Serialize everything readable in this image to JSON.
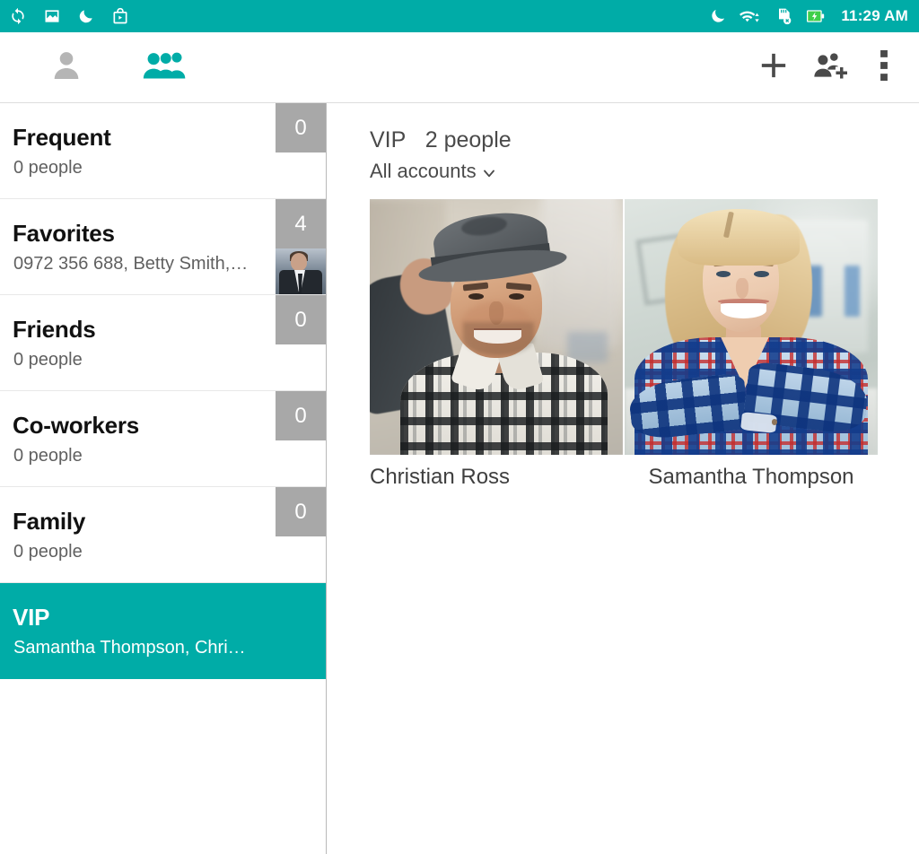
{
  "statusbar": {
    "time": "11:29 AM",
    "left_icons": [
      {
        "name": "sync-icon",
        "label": "sync"
      },
      {
        "name": "photo-icon",
        "label": "photo"
      },
      {
        "name": "do-not-disturb-moon-icon",
        "label": "do not disturb"
      },
      {
        "name": "app-store-bag-icon",
        "label": "store"
      }
    ],
    "right_icons": [
      {
        "name": "moon-icon",
        "label": "night mode"
      },
      {
        "name": "wifi-icon",
        "label": "wifi"
      },
      {
        "name": "sd-card-removed-icon",
        "label": "sd card removed"
      },
      {
        "name": "battery-charging-icon",
        "label": "battery charging"
      }
    ],
    "background_color": "#00ACA7"
  },
  "toolbar": {
    "tabs": [
      {
        "name": "contacts-tab",
        "icon": "person-icon",
        "active": false
      },
      {
        "name": "groups-tab",
        "icon": "group-icon",
        "active": true
      }
    ],
    "actions": [
      {
        "name": "add-button",
        "icon": "plus-icon"
      },
      {
        "name": "add-group-button",
        "icon": "person-add-icon"
      },
      {
        "name": "overflow-menu-button",
        "icon": "more-vertical-icon"
      }
    ],
    "accent_color": "#00ACA7",
    "inactive_color": "#b5b5b5"
  },
  "sidebar": {
    "groups": [
      {
        "title": "Frequent",
        "subtitle": "0 people",
        "count": "0",
        "selected": false,
        "has_thumb": false
      },
      {
        "title": "Favorites",
        "subtitle": "0972 356 688, Betty Smith,…",
        "count": "4",
        "selected": false,
        "has_thumb": true
      },
      {
        "title": "Friends",
        "subtitle": "0 people",
        "count": "0",
        "selected": false,
        "has_thumb": false
      },
      {
        "title": "Co-workers",
        "subtitle": "0 people",
        "count": "0",
        "selected": false,
        "has_thumb": false
      },
      {
        "title": "Family",
        "subtitle": "0 people",
        "count": "0",
        "selected": false,
        "has_thumb": false
      },
      {
        "title": "VIP",
        "subtitle": "Samantha Thompson, Chri…",
        "count": "",
        "selected": true,
        "has_thumb": false
      }
    ],
    "badge_color": "#a8a8a8",
    "selected_color": "#00ACA7"
  },
  "main": {
    "group_name": "VIP",
    "people_count": "2 people",
    "account_filter": "All accounts",
    "account_caret": "chevron-down-icon",
    "people": [
      {
        "name": "Christian Ross",
        "photo": "man-with-hat-plaid-shirt"
      },
      {
        "name": "Samantha Thompson",
        "photo": "blonde-woman-blue-plaid-shirt"
      }
    ]
  }
}
